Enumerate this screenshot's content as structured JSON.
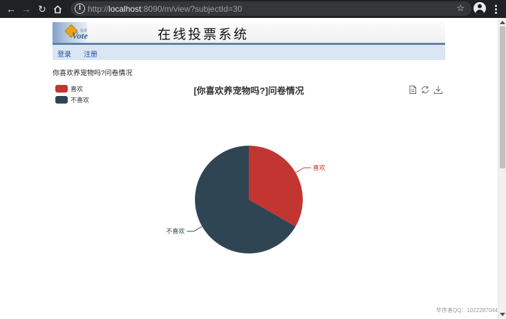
{
  "browser": {
    "url_host": "localhost",
    "url_rest": ":8090/m/view?subjectId=30",
    "url_prefix": "http://"
  },
  "header": {
    "logo_text": "Vote",
    "logo_small_text": "投票",
    "site_title": "在线投票系统"
  },
  "nav": {
    "login": "登录",
    "register": "注册"
  },
  "page": {
    "heading": "你喜欢养宠物吗?问卷情况"
  },
  "chart_data": {
    "type": "pie",
    "title": "[你喜欢养宠物吗?]问卷情况",
    "legend_position": "top-left",
    "series": [
      {
        "name": "喜欢",
        "value": 1,
        "color": "#c23531"
      },
      {
        "name": "不喜欢",
        "value": 2,
        "color": "#2f4554"
      }
    ]
  },
  "toolbox": {
    "icons": [
      "data-view-icon",
      "restore-icon",
      "save-image-icon"
    ]
  },
  "watermark": "毕序者QQ：1022287044"
}
